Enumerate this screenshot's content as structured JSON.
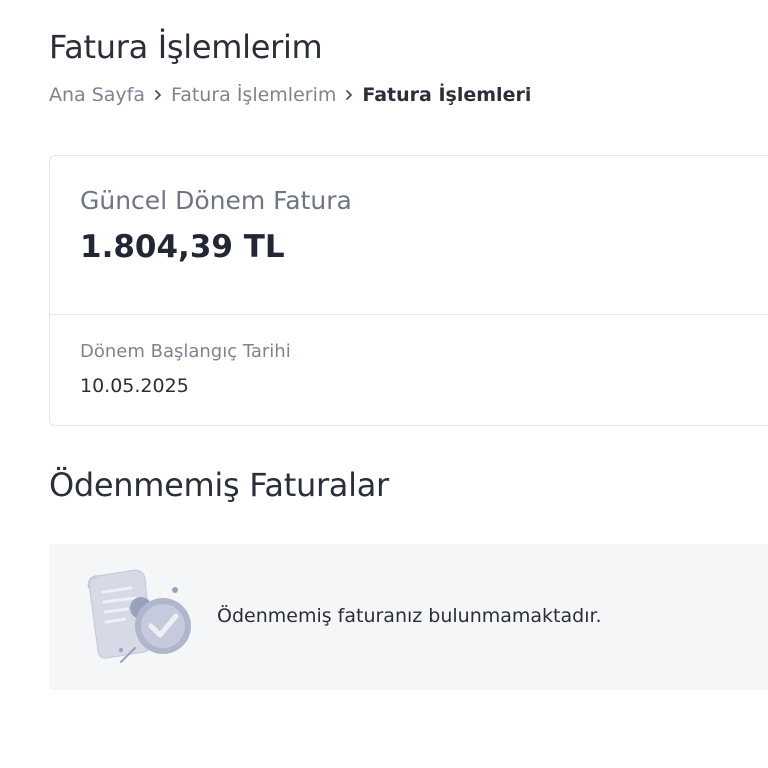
{
  "header": {
    "title": "Fatura İşlemlerim"
  },
  "breadcrumb": {
    "items": [
      {
        "label": "Ana Sayfa"
      },
      {
        "label": "Fatura İşlemlerim"
      },
      {
        "label": "Fatura İşlemleri"
      }
    ]
  },
  "current_invoice": {
    "label": "Güncel Dönem Fatura",
    "amount": "1.804,39 TL",
    "period_start_label": "Dönem Başlangıç Tarihi",
    "period_start_value": "10.05.2025"
  },
  "unpaid": {
    "title": "Ödenmemiş Faturalar",
    "empty_message": "Ödenmemiş faturanız bulunmamaktadır.",
    "illustration_icon": "invoice-paid-illustration-icon"
  },
  "icons": {
    "breadcrumb_separator": "chevron-right-icon"
  },
  "colors": {
    "text_primary": "#2b2f3a",
    "text_muted": "#7d8391",
    "border": "#e3e6ec",
    "empty_bg": "#f5f6f8",
    "illustration": "#b9bfd3"
  }
}
